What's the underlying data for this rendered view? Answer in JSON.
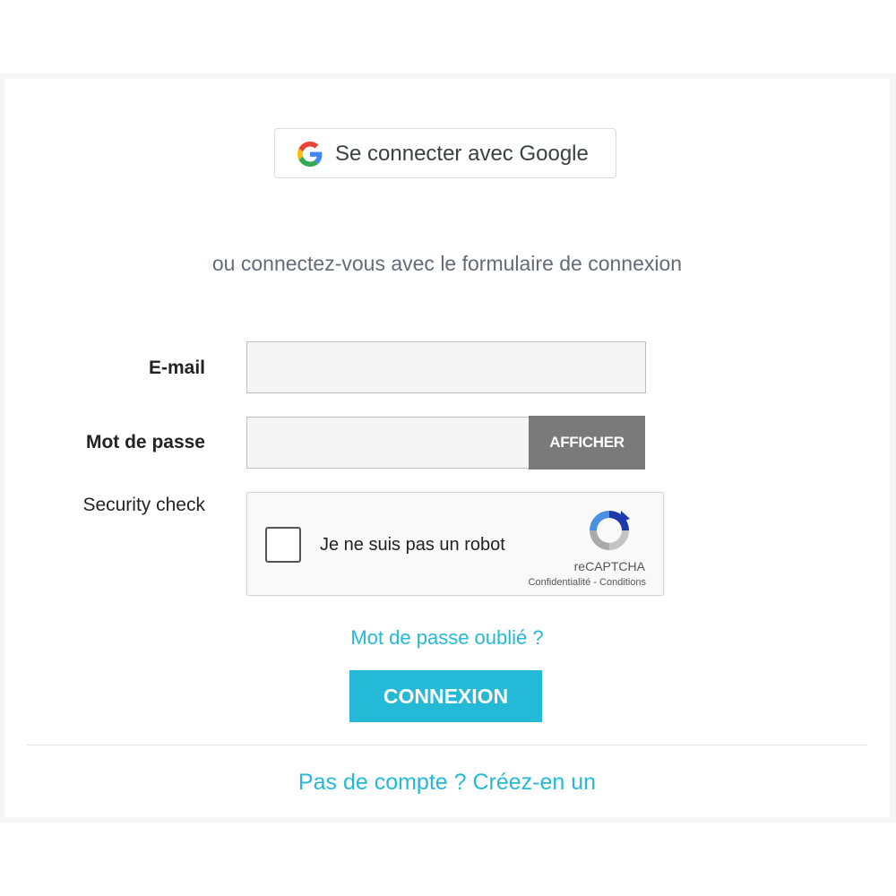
{
  "google_button": {
    "label": "Se connecter avec Google",
    "icon": "google-icon"
  },
  "divider_text": "ou connectez-vous avec le formulaire de connexion",
  "form": {
    "email_label": "E-mail",
    "email_value": "",
    "password_label": "Mot de passe",
    "password_value": "",
    "show_password_label": "AFFICHER",
    "security_label": "Security check"
  },
  "recaptcha": {
    "checkbox_label": "Je ne suis pas un robot",
    "brand": "reCAPTCHA",
    "privacy": "Confidentialité",
    "separator": " - ",
    "terms": "Conditions",
    "icon": "recaptcha-logo-icon"
  },
  "forgot_password": "Mot de passe oublié ?",
  "submit_label": "CONNEXION",
  "signup_link": "Pas de compte ? Créez-en un",
  "colors": {
    "accent": "#24b9d7",
    "show_button": "#7a7a7a",
    "input_bg": "#f5f5f5"
  }
}
